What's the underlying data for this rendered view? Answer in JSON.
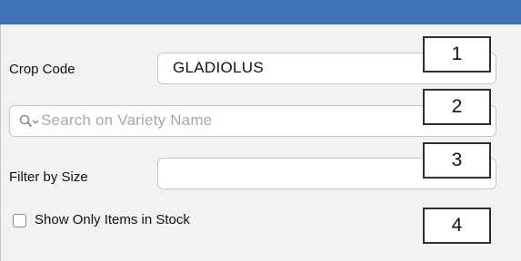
{
  "form": {
    "crop_code_label": "Crop Code",
    "crop_code_value": "GLADIOLUS",
    "search_placeholder": "Search on Variety Name",
    "filter_size_label": "Filter by Size",
    "filter_size_value": "",
    "in_stock_label": "Show Only Items in Stock",
    "in_stock_checked": false
  },
  "callouts": [
    "1",
    "2",
    "3",
    "4"
  ],
  "colors": {
    "titlebar": "#3f73b5",
    "panel": "#f2f2f2"
  },
  "icons": {
    "search": "magnifier-dropdown-icon"
  }
}
